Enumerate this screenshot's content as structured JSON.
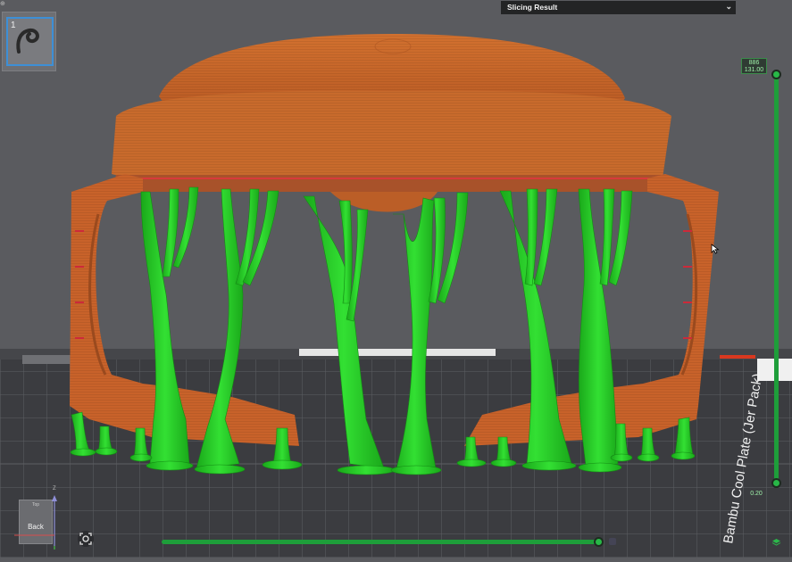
{
  "plate": {
    "number": "1",
    "icon": "filament-hook-icon"
  },
  "slicing_panel": {
    "title": "Slicing Result",
    "toggle_icon": "chevron-double-down-icon"
  },
  "layer_slider": {
    "top_layer": "886",
    "top_height": "131.00",
    "bottom_height": "0.20"
  },
  "view_cube": {
    "face_label": "Back",
    "top_label": "Top",
    "axis_label": "Z"
  },
  "bed": {
    "plate_text": "Bambu Cool Plate (Jer Pack)"
  },
  "colors": {
    "model": "#c8622a",
    "support": "#22cc22",
    "accent": "#2bb84a",
    "background": "#5a5b5f"
  },
  "icons": {
    "camera": "camera-reset-icon",
    "layers": "layers-icon",
    "cursor": "mouse-cursor-icon"
  }
}
